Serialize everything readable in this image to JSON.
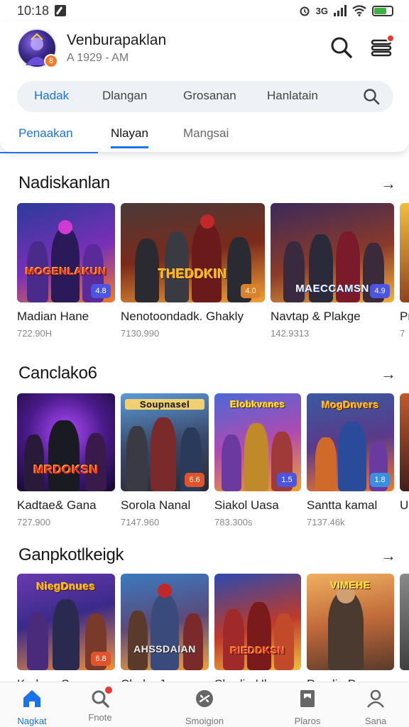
{
  "status": {
    "time": "10:18",
    "network": "3G"
  },
  "profile": {
    "name": "Venburapaklan",
    "subtitle": "A 1929 - AM"
  },
  "search": {
    "chips": [
      "Hadak",
      "Dlangan",
      "Grosanan",
      "Hanlatain"
    ]
  },
  "tabs": [
    "Penaakan",
    "Nlayan",
    "Mangsai"
  ],
  "sections": [
    {
      "title": "Nadiskanlan",
      "arrow": "→",
      "cards": [
        {
          "name": "Madian Hane",
          "count": "722.90H",
          "art_title": "MOGENLAKUN",
          "rating": "4.8",
          "rating_color": "#4b55e0"
        },
        {
          "name": "Nenotoondadk. Ghakly",
          "count": "7130.990",
          "art_title": "THEDDKIN",
          "rating": "4.0",
          "rating_color": "#d9822b"
        },
        {
          "name": "Navtap & Plakge",
          "count": "142.9313",
          "art_title": "MAECCAMSN",
          "rating": "4.9",
          "rating_color": "#4b55e0"
        },
        {
          "name": "Pr",
          "count": "7",
          "art_title": "",
          "rating": "",
          "rating_color": "#4b55e0"
        }
      ]
    },
    {
      "title": "Canclako6",
      "arrow": "→",
      "cards": [
        {
          "name": "Kadtae& Gana",
          "count": "727.900",
          "art_title": "MRDOKSN",
          "rating": "",
          "rating_color": "#4b55e0"
        },
        {
          "name": "Sorola Nanal",
          "count": "7147.960",
          "art_title": "Soupnasel",
          "rating": "6.6",
          "rating_color": "#e0532b"
        },
        {
          "name": "Siakol Uasa",
          "count": "783.300s",
          "art_title": "Elobkvanes",
          "rating": "1.5",
          "rating_color": "#4b55e0"
        },
        {
          "name": "Santta kamal",
          "count": "7137.46k",
          "art_title": "MogDnvers",
          "rating": "1.8",
          "rating_color": "#3a8fe0"
        },
        {
          "name": "U",
          "count": "",
          "art_title": "",
          "rating": "",
          "rating_color": "#4b55e0"
        }
      ]
    },
    {
      "title": "Ganpkotlkeigk",
      "arrow": "→",
      "cards": [
        {
          "name": "Kadnes Suna",
          "count": "",
          "art_title": "NiegDnues",
          "rating": "6.8",
          "rating_color": "#e0532b"
        },
        {
          "name": "Clorko Jemm",
          "count": "",
          "art_title": "AHSSDAIAN",
          "rating": "",
          "rating_color": "#4b55e0"
        },
        {
          "name": "Slardie Ulam",
          "count": "",
          "art_title": "RIEDDKSN",
          "rating": "",
          "rating_color": "#4b55e0"
        },
        {
          "name": "Pondia Pann",
          "count": "",
          "art_title": "VIMEHE",
          "rating": "",
          "rating_color": "#e0532b"
        }
      ]
    }
  ],
  "bottom_nav": [
    "Nagkat",
    "Fnote",
    "Smoigion",
    "Plaros",
    "Sana"
  ],
  "colors": {
    "accent": "#1a73e8",
    "badge_red": "#e53935"
  }
}
